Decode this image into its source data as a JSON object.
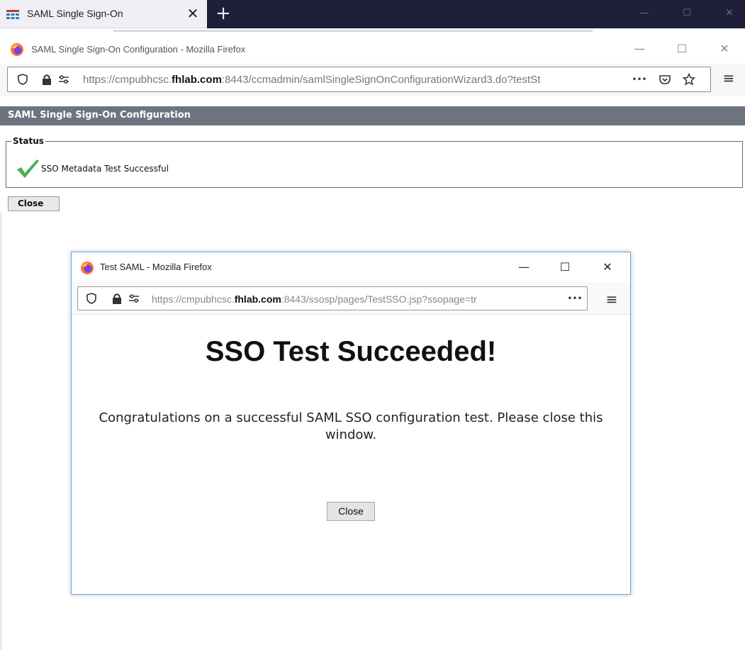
{
  "browser_tab": {
    "title": "SAML Single Sign-On",
    "close_glyph": "✕",
    "new_tab_glyph": "+",
    "icon": "grid-app-icon"
  },
  "main_window": {
    "title": "SAML Single Sign-On Configuration - Mozilla Firefox",
    "url_prefix": "https://cmpubhcsc.",
    "url_domain": "fhlab.com",
    "url_suffix": ":8443/ccmadmin/samlSingleSignOnConfigurationWizard3.do?testSt",
    "more_glyph": "•••",
    "menu_glyph": "≡",
    "minimize_glyph": "—",
    "maximize_glyph": "☐",
    "close_glyph": "✕"
  },
  "app": {
    "header_title": "SAML Single Sign-On Configuration",
    "status_legend": "Status",
    "status_text": "SSO Metadata Test Successful",
    "close_button": "Close",
    "status_color": "#4caf50"
  },
  "popup": {
    "title": "Test SAML - Mozilla Firefox",
    "url_prefix": "https://cmpubhcsc.",
    "url_domain": "fhlab.com",
    "url_suffix": ":8443/ssosp/pages/TestSSO.jsp?ssopage=tr",
    "more_glyph": "•••",
    "menu_glyph": "≡",
    "minimize_glyph": "—",
    "maximize_glyph": "☐",
    "close_glyph": "✕",
    "heading": "SSO Test Succeeded!",
    "message": "Congratulations on a successful SAML SSO configuration test. Please close this window.",
    "close_button": "Close"
  }
}
